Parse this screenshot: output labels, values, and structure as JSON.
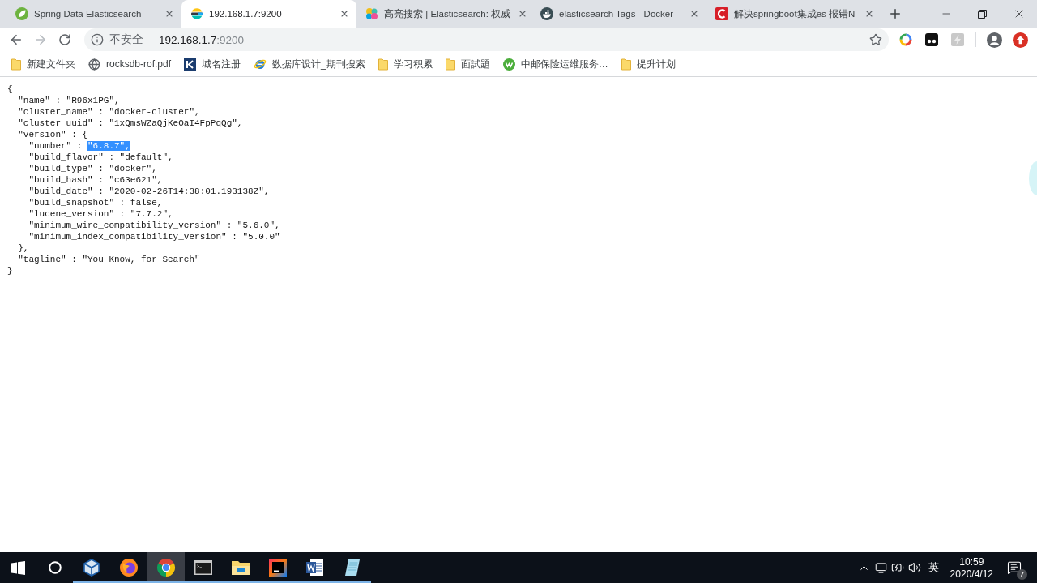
{
  "tabs": [
    {
      "kind": "leaf",
      "title": "Spring Data Elasticsearch",
      "selected": false
    },
    {
      "kind": "bands",
      "title": "192.168.1.7:9200",
      "selected": true
    },
    {
      "kind": "dots",
      "title": "高亮搜索 | Elasticsearch: 权威",
      "selected": false
    },
    {
      "kind": "whale",
      "title": "elasticsearch Tags - Docker",
      "selected": false
    },
    {
      "kind": "tile",
      "title": "解决springboot集成es 报错N",
      "selected": false
    }
  ],
  "toolbar": {
    "nav": [
      {
        "kind": "back",
        "disabled": false
      },
      {
        "kind": "forward",
        "disabled": true
      },
      {
        "kind": "reload",
        "disabled": false
      }
    ],
    "omnibox": {
      "security_label": "不安全",
      "host": "192.168.1.7",
      "port": ":9200"
    }
  },
  "bookmarks": [
    {
      "kind": "folder",
      "label": "新建文件夹"
    },
    {
      "kind": "globe",
      "label": "rocksdb-rof.pdf"
    },
    {
      "kind": "tile",
      "label": "域名注册"
    },
    {
      "kind": "orbit",
      "label": "数据库设计_期刊搜索"
    },
    {
      "kind": "folder",
      "label": "学习积累"
    },
    {
      "kind": "folder",
      "label": "面試題"
    },
    {
      "kind": "round",
      "label": "中邮保险运维服务…"
    },
    {
      "kind": "folder",
      "label": "提升计划"
    }
  ],
  "page": {
    "lines": [
      {
        "text": "{",
        "children": [
          {
            "text": "\"name\" : \"R96x1PG\","
          },
          {
            "text": "\"cluster_name\" : \"docker-cluster\","
          },
          {
            "text": "\"cluster_uuid\" : \"1xQmsWZaQjKeOaI4FpPqQg\","
          },
          {
            "text": "\"version\" : {",
            "children": [
              {
                "segments": [
                  {
                    "text": "\"number\" : ",
                    "selected": false
                  },
                  {
                    "text": "\"6.8.7\",",
                    "selected": true
                  }
                ]
              },
              {
                "text": "\"build_flavor\" : \"default\","
              },
              {
                "text": "\"build_type\" : \"docker\","
              },
              {
                "text": "\"build_hash\" : \"c63e621\","
              },
              {
                "text": "\"build_date\" : \"2020-02-26T14:38:01.193138Z\","
              },
              {
                "text": "\"build_snapshot\" : false,"
              },
              {
                "text": "\"lucene_version\" : \"7.7.2\","
              },
              {
                "text": "\"minimum_wire_compatibility_version\" : \"5.6.0\","
              },
              {
                "text": "\"minimum_index_compatibility_version\" : \"5.0.0\""
              }
            ]
          },
          {
            "text": "},"
          },
          {
            "text": "\"tagline\" : \"You Know, for Search\""
          }
        ]
      },
      {
        "text": "}"
      }
    ]
  },
  "taskbar": {
    "apps": [
      {
        "kind": "cube",
        "running": true,
        "selected": false
      },
      {
        "kind": "fox",
        "running": true,
        "selected": false
      },
      {
        "kind": "browser",
        "running": true,
        "selected": true
      },
      {
        "kind": "terminal",
        "running": true,
        "selected": false
      },
      {
        "kind": "folder",
        "running": true,
        "selected": false
      },
      {
        "kind": "ide",
        "running": true,
        "selected": false
      },
      {
        "kind": "document",
        "running": true,
        "selected": false
      },
      {
        "kind": "notepad",
        "running": true,
        "selected": false
      }
    ],
    "tray": {
      "input_method": "英",
      "time": "10:59",
      "date": "2020/4/12",
      "notification_count": "7"
    }
  }
}
